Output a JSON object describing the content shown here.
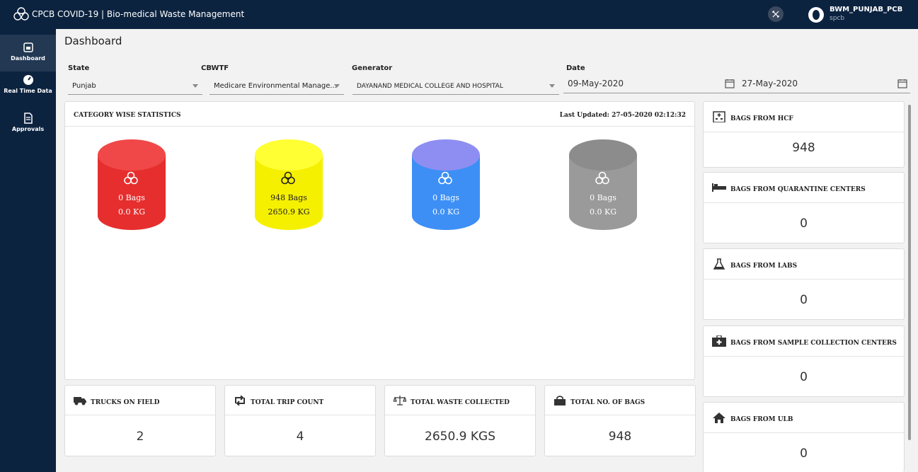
{
  "app": {
    "title": "CPCB COVID-19 | Bio-medical Waste Management",
    "user_name": "BWM_PUNJAB_PCB",
    "user_role": "spcb"
  },
  "sidebar": {
    "items": [
      {
        "label": "Dashboard",
        "icon": "dashboard-icon"
      },
      {
        "label": "Real Time Data",
        "icon": "speedometer-icon"
      },
      {
        "label": "Approvals",
        "icon": "document-icon"
      }
    ]
  },
  "page": {
    "title": "Dashboard"
  },
  "filters": {
    "state_label": "State",
    "state_value": "Punjab",
    "cbwtf_label": "CBWTF",
    "cbwtf_value": "Medicare Environmental Manage...",
    "generator_label": "Generator",
    "generator_value": "DAYANAND MEDICAL COLLEGE AND HOSPITAL",
    "date_label": "Date",
    "date_from": "09-May-2020",
    "date_to": "27-May-2020"
  },
  "category_stats": {
    "title": "CATEGORY WISE STATISTICS",
    "last_updated": "Last Updated: 27-05-2020 02:12:32",
    "cylinders": [
      {
        "bags": "0 Bags",
        "kg": "0.0 KG",
        "color": "#e62e2e",
        "top_color": "#f04848",
        "text_color": "#ffffff"
      },
      {
        "bags": "948 Bags",
        "kg": "2650.9 KG",
        "color": "#f5f000",
        "top_color": "#ffff33",
        "text_color": "#222222"
      },
      {
        "bags": "0 Bags",
        "kg": "0.0 KG",
        "color": "#3d8ff5",
        "top_color": "#8e8ef2",
        "text_color": "#ffffff"
      },
      {
        "bags": "0 Bags",
        "kg": "0.0 KG",
        "color": "#9a9a9a",
        "top_color": "#8c8c8c",
        "text_color": "#ffffff"
      }
    ]
  },
  "stats": [
    {
      "label": "TRUCKS ON FIELD",
      "value": "2",
      "icon": "truck-icon"
    },
    {
      "label": "TOTAL TRIP COUNT",
      "value": "4",
      "icon": "retweet-icon"
    },
    {
      "label": "TOTAL WASTE COLLECTED",
      "value": "2650.9 KGS",
      "icon": "scale-icon"
    },
    {
      "label": "TOTAL NO. OF BAGS",
      "value": "948",
      "icon": "shopping-bag-icon"
    }
  ],
  "right_cards": [
    {
      "label": "BAGS FROM HCF",
      "value": "948",
      "icon": "hospital-icon"
    },
    {
      "label": "BAGS FROM QUARANTINE CENTERS",
      "value": "0",
      "icon": "bed-icon"
    },
    {
      "label": "BAGS FROM LABS",
      "value": "0",
      "icon": "flask-icon"
    },
    {
      "label": "BAGS FROM SAMPLE COLLECTION CENTERS",
      "value": "0",
      "icon": "medical-kit-icon"
    },
    {
      "label": "BAGS FROM ULB",
      "value": "0",
      "icon": "home-icon"
    }
  ]
}
